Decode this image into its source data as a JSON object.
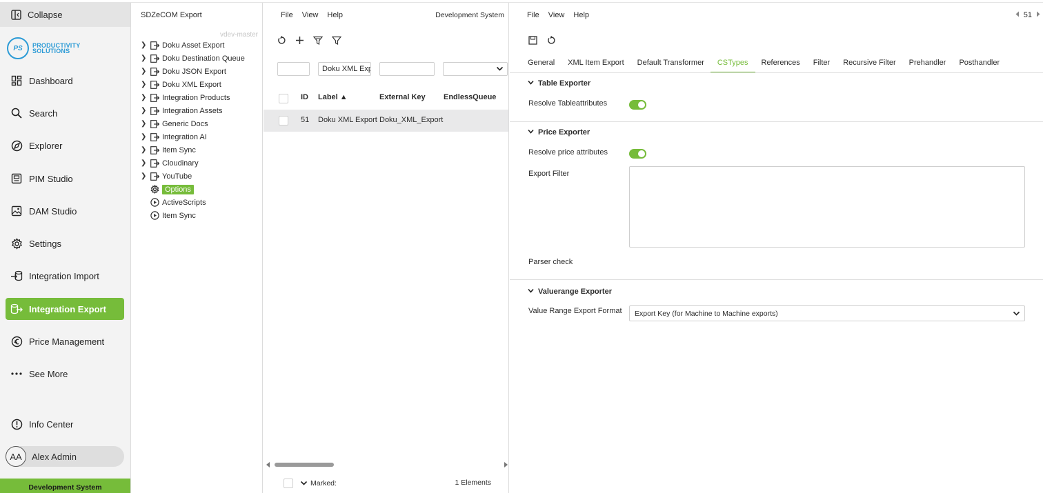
{
  "nav": {
    "collapse_label": "Collapse",
    "logo": {
      "initials": "PS",
      "line1": "PRODUCTIVITY",
      "line2": "SOLUTIONS"
    },
    "items": [
      {
        "label": "Dashboard",
        "icon": "dashboard-icon"
      },
      {
        "label": "Search",
        "icon": "search-icon"
      },
      {
        "label": "Explorer",
        "icon": "explorer-icon"
      },
      {
        "label": "PIM Studio",
        "icon": "pim-studio-icon"
      },
      {
        "label": "DAM Studio",
        "icon": "image-icon"
      },
      {
        "label": "Settings",
        "icon": "gear-icon"
      },
      {
        "label": "Integration Import",
        "icon": "import-icon"
      },
      {
        "label": "Integration Export",
        "icon": "export-icon",
        "active": true
      },
      {
        "label": "Price Management",
        "icon": "euro-icon"
      },
      {
        "label": "See More",
        "icon": "more-dots-icon"
      }
    ],
    "info_center": "Info Center",
    "user": {
      "initials": "AA",
      "name": "Alex Admin"
    },
    "environment": "Development System",
    "accent_color": "#76bc3a"
  },
  "tree": {
    "title": "SDZeCOM Export",
    "version": "vdev-master",
    "nodes": [
      "Doku Asset Export",
      "Doku Destination Queue",
      "Doku JSON Export",
      "Doku XML Export",
      "Integration Products",
      "Integration Assets",
      "Generic Docs",
      "Integration AI",
      "Item Sync",
      "Cloudinary",
      "YouTube"
    ],
    "leaves": [
      {
        "label": "Options",
        "icon": "gear-icon",
        "selected": true
      },
      {
        "label": "ActiveScripts",
        "icon": "play-circle-icon"
      },
      {
        "label": "Item Sync",
        "icon": "play-circle-icon"
      }
    ]
  },
  "list": {
    "menu": [
      "File",
      "View",
      "Help"
    ],
    "environment": "Development System",
    "filters": [
      "",
      "Doku XML Expo",
      "",
      ""
    ],
    "columns": [
      "ID",
      "Label ▲",
      "External Key",
      "EndlessQueue"
    ],
    "rows": [
      {
        "id": "51",
        "label": "Doku XML Export",
        "external_key": "Doku_XML_Export",
        "endless_queue": ""
      }
    ],
    "footer": {
      "marked": "Marked:",
      "count": "1 Elements"
    }
  },
  "detail": {
    "menu": [
      "File",
      "View",
      "Help"
    ],
    "record_id": "51",
    "tabs": [
      "General",
      "XML Item Export",
      "Default Transformer",
      "CSTypes",
      "References",
      "Filter",
      "Recursive Filter",
      "Prehandler",
      "Posthandler"
    ],
    "active_tab": "CSTypes",
    "sections": {
      "table_exporter": {
        "title": "Table Exporter",
        "resolve_label": "Resolve Tableattributes",
        "resolve_on": true
      },
      "price_exporter": {
        "title": "Price Exporter",
        "resolve_label": "Resolve price attributes",
        "resolve_on": true,
        "filter_label": "Export Filter",
        "filter_value": "",
        "parser_label": "Parser check"
      },
      "valuerange_exporter": {
        "title": "Valuerange Exporter",
        "format_label": "Value Range Export Format",
        "format_value": "Export Key (for Machine to Machine exports)"
      }
    }
  }
}
